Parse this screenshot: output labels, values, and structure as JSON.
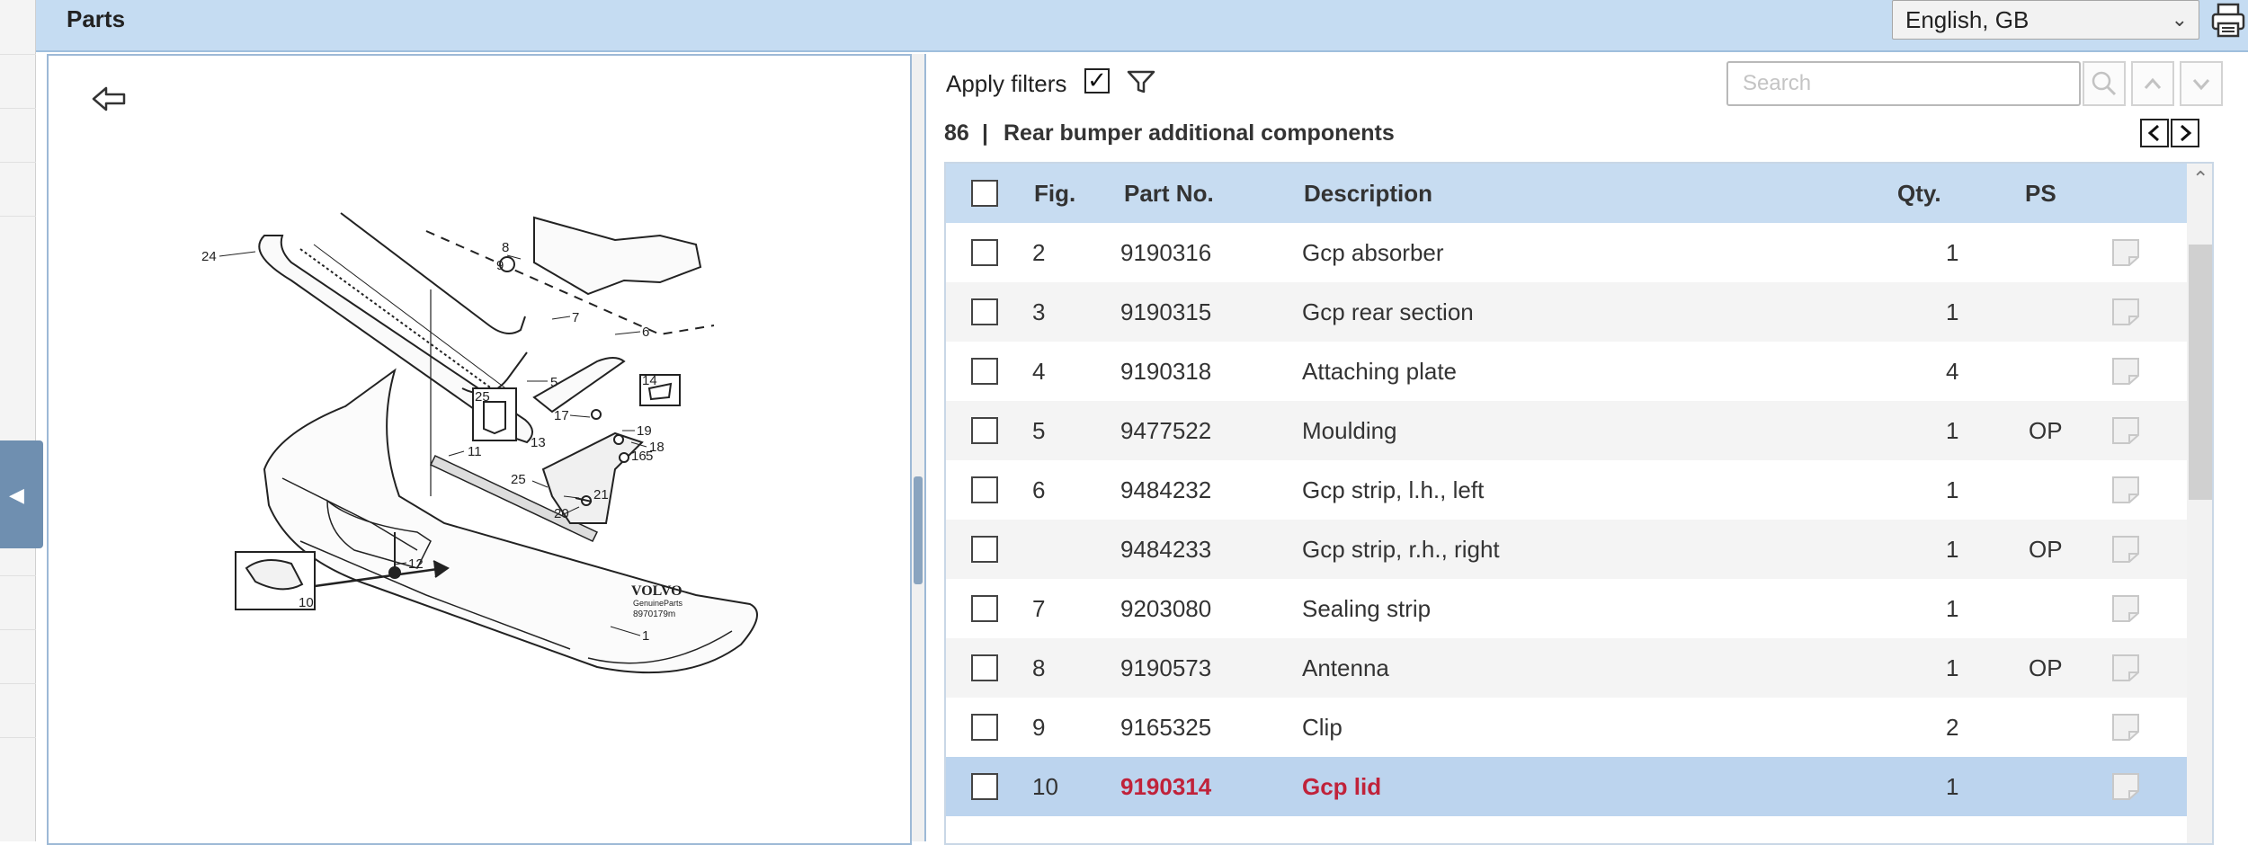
{
  "header": {
    "title": "Parts"
  },
  "language": {
    "selected": "English, GB"
  },
  "icons": {
    "print": "printer-icon",
    "back": "back-arrow-icon",
    "filter": "filter-funnel-icon",
    "search": "search-icon",
    "up": "chevron-up-icon",
    "down": "chevron-down-icon",
    "note": "note-icon"
  },
  "filters": {
    "label": "Apply filters",
    "checked": true
  },
  "search": {
    "placeholder": "Search"
  },
  "section": {
    "number": "86",
    "separator": "|",
    "title": "Rear bumper additional components"
  },
  "table": {
    "columns": {
      "fig": "Fig.",
      "part_no": "Part No.",
      "description": "Description",
      "qty": "Qty.",
      "ps": "PS"
    },
    "rows": [
      {
        "fig": "2",
        "part_no": "9190316",
        "description": "Gcp absorber",
        "qty": "1",
        "ps": ""
      },
      {
        "fig": "3",
        "part_no": "9190315",
        "description": "Gcp rear section",
        "qty": "1",
        "ps": ""
      },
      {
        "fig": "4",
        "part_no": "9190318",
        "description": "Attaching plate",
        "qty": "4",
        "ps": ""
      },
      {
        "fig": "5",
        "part_no": "9477522",
        "description": "Moulding",
        "qty": "1",
        "ps": "OP"
      },
      {
        "fig": "6",
        "part_no": "9484232",
        "description": "Gcp strip, l.h., left",
        "qty": "1",
        "ps": ""
      },
      {
        "fig": "",
        "part_no": "9484233",
        "description": "Gcp strip, r.h., right",
        "qty": "1",
        "ps": "OP"
      },
      {
        "fig": "7",
        "part_no": "9203080",
        "description": "Sealing strip",
        "qty": "1",
        "ps": ""
      },
      {
        "fig": "8",
        "part_no": "9190573",
        "description": "Antenna",
        "qty": "1",
        "ps": "OP"
      },
      {
        "fig": "9",
        "part_no": "9165325",
        "description": "Clip",
        "qty": "2",
        "ps": ""
      },
      {
        "fig": "10",
        "part_no": "9190314",
        "description": "Gcp lid",
        "qty": "1",
        "ps": "",
        "selected": true
      }
    ]
  },
  "diagram": {
    "callouts": [
      "24",
      "8",
      "9",
      "7",
      "6",
      "5",
      "14",
      "25",
      "17",
      "19",
      "18",
      "11",
      "13",
      "16",
      "5",
      "25",
      "21",
      "20",
      "1",
      "12",
      "10"
    ],
    "brand": "VOLVO",
    "brand_sub": "GenuineParts",
    "code": "8970179m"
  },
  "colors": {
    "header_bg": "#c5dcf2",
    "selected_row": "#bcd4ee",
    "selected_text": "#c0223a"
  }
}
